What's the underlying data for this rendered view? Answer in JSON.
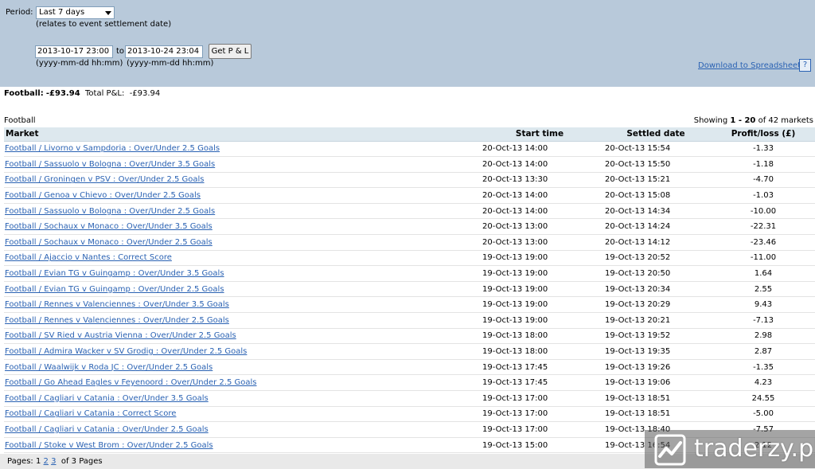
{
  "filter": {
    "period_label": "Period:",
    "period_value": "Last 7 days",
    "period_note": "(relates to event settlement date)",
    "from_value": "2013-10-17 23:00",
    "to_label": "to",
    "to_value": "2013-10-24 23:04",
    "get_pl_label": "Get P & L",
    "format_hint_from": "(yyyy-mm-dd hh:mm)",
    "format_hint_to": "(yyyy-mm-dd hh:mm)",
    "download_label": "Download to Spreadsheet",
    "help_label": "?"
  },
  "summary": {
    "sport_label": "Football:",
    "sport_value": "-£93.94",
    "total_label": "Total P&L:",
    "total_value": "-£93.94"
  },
  "section_title": "Football",
  "showing": {
    "prefix": "Showing",
    "range": "1 - 20",
    "suffix": "of 42 markets"
  },
  "table": {
    "headers": {
      "market": "Market",
      "start": "Start time",
      "settled": "Settled date",
      "pl": "Profit/loss (£)"
    },
    "rows": [
      {
        "market": "Football / Livorno v Sampdoria : Over/Under 2.5 Goals",
        "start": "20-Oct-13 14:00",
        "settled": "20-Oct-13 15:54",
        "pl": "-1.33"
      },
      {
        "market": "Football / Sassuolo v Bologna : Over/Under 3.5 Goals",
        "start": "20-Oct-13 14:00",
        "settled": "20-Oct-13 15:50",
        "pl": "-1.18"
      },
      {
        "market": "Football / Groningen v PSV : Over/Under 2.5 Goals",
        "start": "20-Oct-13 13:30",
        "settled": "20-Oct-13 15:21",
        "pl": "-4.70"
      },
      {
        "market": "Football / Genoa v Chievo : Over/Under 2.5 Goals",
        "start": "20-Oct-13 14:00",
        "settled": "20-Oct-13 15:08",
        "pl": "-1.03"
      },
      {
        "market": "Football / Sassuolo v Bologna : Over/Under 2.5 Goals",
        "start": "20-Oct-13 14:00",
        "settled": "20-Oct-13 14:34",
        "pl": "-10.00"
      },
      {
        "market": "Football / Sochaux v Monaco : Over/Under 3.5 Goals",
        "start": "20-Oct-13 13:00",
        "settled": "20-Oct-13 14:24",
        "pl": "-22.31"
      },
      {
        "market": "Football / Sochaux v Monaco : Over/Under 2.5 Goals",
        "start": "20-Oct-13 13:00",
        "settled": "20-Oct-13 14:12",
        "pl": "-23.46"
      },
      {
        "market": "Football / Ajaccio v Nantes : Correct Score",
        "start": "19-Oct-13 19:00",
        "settled": "19-Oct-13 20:52",
        "pl": "-11.00"
      },
      {
        "market": "Football / Evian TG v Guingamp : Over/Under 3.5 Goals",
        "start": "19-Oct-13 19:00",
        "settled": "19-Oct-13 20:50",
        "pl": "1.64"
      },
      {
        "market": "Football / Evian TG v Guingamp : Over/Under 2.5 Goals",
        "start": "19-Oct-13 19:00",
        "settled": "19-Oct-13 20:34",
        "pl": "2.55"
      },
      {
        "market": "Football / Rennes v Valenciennes : Over/Under 3.5 Goals",
        "start": "19-Oct-13 19:00",
        "settled": "19-Oct-13 20:29",
        "pl": "9.43"
      },
      {
        "market": "Football / Rennes v Valenciennes : Over/Under 2.5 Goals",
        "start": "19-Oct-13 19:00",
        "settled": "19-Oct-13 20:21",
        "pl": "-7.13"
      },
      {
        "market": "Football / SV Ried v Austria Vienna : Over/Under 2.5 Goals",
        "start": "19-Oct-13 18:00",
        "settled": "19-Oct-13 19:52",
        "pl": "2.98"
      },
      {
        "market": "Football / Admira Wacker v SV Grodig : Over/Under 2.5 Goals",
        "start": "19-Oct-13 18:00",
        "settled": "19-Oct-13 19:35",
        "pl": "2.87"
      },
      {
        "market": "Football / Waalwijk v Roda JC : Over/Under 2.5 Goals",
        "start": "19-Oct-13 17:45",
        "settled": "19-Oct-13 19:26",
        "pl": "-1.35"
      },
      {
        "market": "Football / Go Ahead Eagles v Feyenoord : Over/Under 2.5 Goals",
        "start": "19-Oct-13 17:45",
        "settled": "19-Oct-13 19:06",
        "pl": "4.23"
      },
      {
        "market": "Football / Cagliari v Catania : Over/Under 3.5 Goals",
        "start": "19-Oct-13 17:00",
        "settled": "19-Oct-13 18:51",
        "pl": "24.55"
      },
      {
        "market": "Football / Cagliari v Catania : Correct Score",
        "start": "19-Oct-13 17:00",
        "settled": "19-Oct-13 18:51",
        "pl": "-5.00"
      },
      {
        "market": "Football / Cagliari v Catania : Over/Under 2.5 Goals",
        "start": "19-Oct-13 17:00",
        "settled": "19-Oct-13 18:40",
        "pl": "-7.57"
      },
      {
        "market": "Football / Stoke v West Brom : Over/Under 2.5 Goals",
        "start": "19-Oct-13 15:00",
        "settled": "19-Oct-13 16:54",
        "pl": "2.12"
      }
    ]
  },
  "pager": {
    "label": "Pages:",
    "current": "1",
    "page2": "2",
    "page3": "3",
    "total": "of 3 Pages"
  },
  "watermark": {
    "text": "traderzy.pl",
    "icon": "traderzy-logo-icon"
  }
}
